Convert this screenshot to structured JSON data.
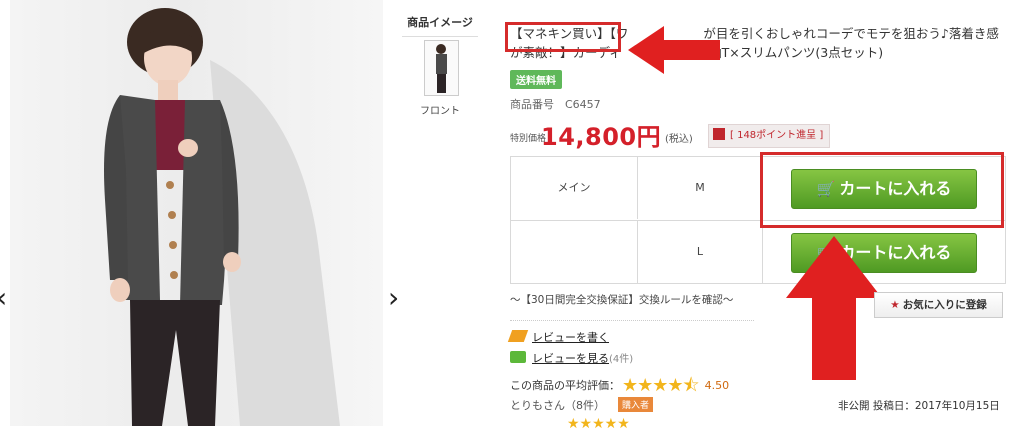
{
  "gallery": {
    "prev_arrow": "‹",
    "next_arrow": "›",
    "thumb_section_title": "商品イメージ",
    "thumb_label": "フロント"
  },
  "product": {
    "title_tag": "【マネキン買い】",
    "title_rest": "【ワ　　　　　　が目を引くおしゃれコーデでモテを狙おう♪落着き感が素敵！】カーディ　　　　ラン長袖T×スリムパンツ(3点セット)",
    "shipping_badge": "送料無料",
    "product_number": "商品番号　C6457",
    "price_label": "特別価格",
    "price": "14,800円",
    "tax": "(税込)",
    "points": "[ 148ポイント進呈 ]"
  },
  "variants": [
    {
      "label": "メイン",
      "size": "M",
      "button": "カートに入れる"
    },
    {
      "label": "",
      "size": "L",
      "button": "カートに入れる"
    }
  ],
  "guarantee_text": "〜【30日間完全交換保証】交換ルールを確認〜",
  "favorite_button": "お気に入りに登録",
  "reviews": {
    "write_link": "レビューを書く",
    "view_link": "レビューを見る",
    "view_count": "(4件)",
    "avg_label": "この商品の平均評価：",
    "avg_value": "4.50",
    "reviewer": "とりもさん（8件）",
    "buyer_badge": "購入者",
    "status": "非公開",
    "posted": "投稿日：2017年10月15日"
  },
  "colors": {
    "price_red": "#d4202a",
    "cart_green": "#5ea82d",
    "annotation_red": "#d52b2b"
  }
}
